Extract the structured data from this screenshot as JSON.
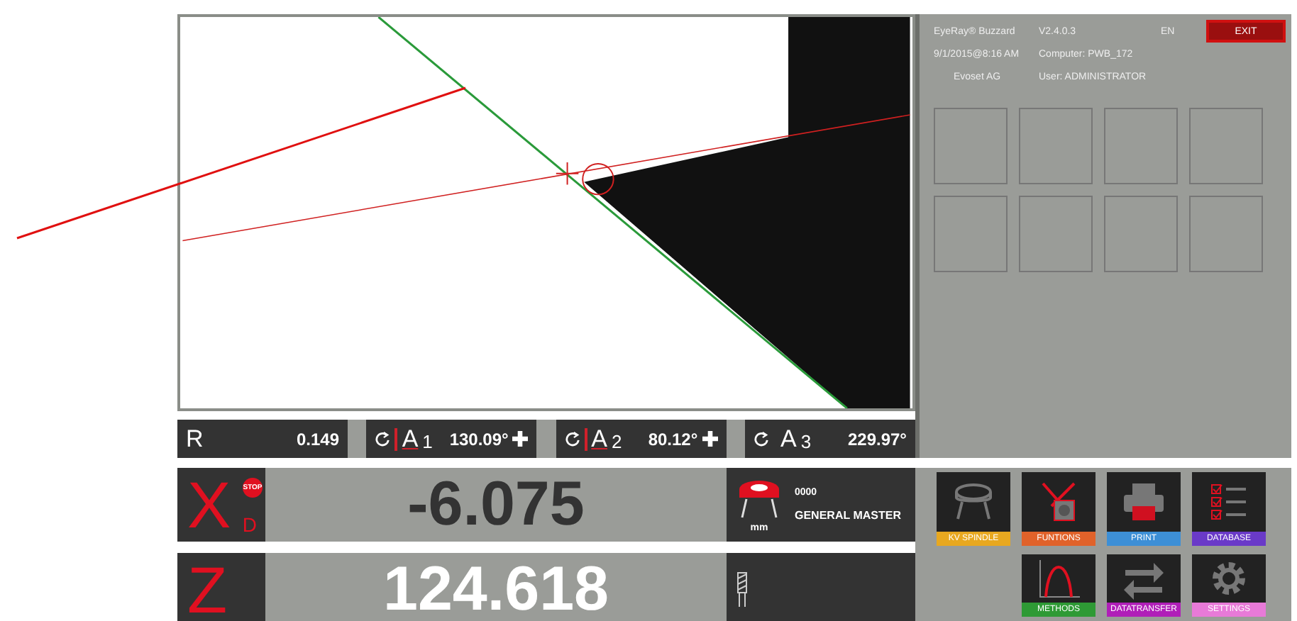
{
  "header": {
    "app_name": "EyeRay® Buzzard",
    "version": "V2.4.0.3",
    "language": "EN",
    "datetime": "9/1/2015@8:16 AM",
    "computer": "Computer: PWB_172",
    "company": "Evoset AG",
    "user": "User: ADMINISTRATOR",
    "exit_button": "EXIT"
  },
  "measurements": [
    {
      "kind": "radius",
      "symbol": "R",
      "value": "0.149",
      "marked": false,
      "add_button": false
    },
    {
      "kind": "angle",
      "symbol": "A",
      "index": "1",
      "value": "130.09°",
      "marked": true,
      "add_button": true
    },
    {
      "kind": "angle",
      "symbol": "A",
      "index": "2",
      "value": "80.12°",
      "marked": true,
      "add_button": true
    },
    {
      "kind": "angle",
      "symbol": "A",
      "index": "3",
      "value": "229.97°",
      "marked": false,
      "add_button": false
    }
  ],
  "axes": [
    {
      "letter": "X",
      "badge": "STOP",
      "subscript": "D",
      "value": "-6.075",
      "highlighted": false
    },
    {
      "letter": "Z",
      "value": "124.618",
      "highlighted": true
    }
  ],
  "tool": {
    "number": "0000",
    "name": "GENERAL MASTER",
    "unit": "mm"
  },
  "functions_row1": [
    {
      "kind": "spindle",
      "label": "KV SPINDLE",
      "color": "#e8a820"
    },
    {
      "kind": "functions",
      "label": "FUNTIONS",
      "color": "#e0622a"
    },
    {
      "kind": "print",
      "label": "PRINT",
      "color": "#3d8fd6"
    },
    {
      "kind": "database",
      "label": "DATABASE",
      "color": "#6a3ac8"
    }
  ],
  "functions_row2": [
    {
      "kind": "methods",
      "label": "METHODS",
      "color": "#2e9a35"
    },
    {
      "kind": "transfer",
      "label": "DATATRANSFER",
      "color": "#b01fb8"
    },
    {
      "kind": "settings",
      "label": "SETTINGS",
      "color": "#e87ad8"
    }
  ]
}
